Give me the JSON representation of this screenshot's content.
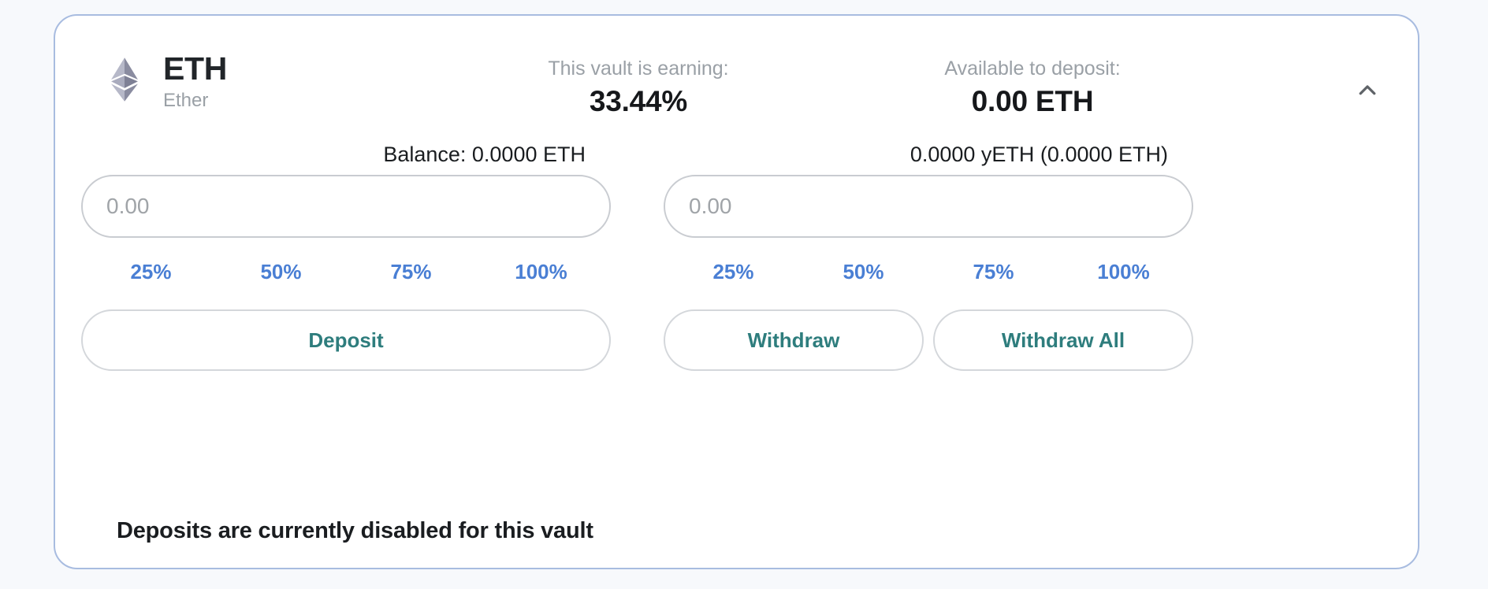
{
  "card": {
    "border_color": "#a8bce0",
    "background": "#ffffff"
  },
  "page": {
    "background": "#f7f9fc"
  },
  "header": {
    "token_logo_icon": "ethereum-diamond-icon",
    "token_symbol": "ETH",
    "token_fullname": "Ether",
    "apy_label": "This vault is earning:",
    "apy_value": "33.44%",
    "available_label": "Available to deposit:",
    "available_value": "0.00 ETH",
    "collapse_icon": "chevron-up-icon"
  },
  "deposit": {
    "balance_label": "Balance: 0.0000 ETH",
    "input_value": "",
    "input_placeholder": "0.00",
    "percentages": [
      "25%",
      "50%",
      "75%",
      "100%"
    ],
    "action_label": "Deposit"
  },
  "withdraw": {
    "balance_label": "0.0000 yETH (0.0000 ETH)",
    "input_value": "",
    "input_placeholder": "0.00",
    "percentages": [
      "25%",
      "50%",
      "75%",
      "100%"
    ],
    "action_label": "Withdraw",
    "action_all_label": "Withdraw All"
  },
  "notice": {
    "text": "Deposits are currently disabled for this vault"
  },
  "colors": {
    "accent_link": "#4a7fd4",
    "accent_action": "#2e7d7d",
    "muted_text": "#9aa0a6",
    "primary_text": "#16181b"
  }
}
